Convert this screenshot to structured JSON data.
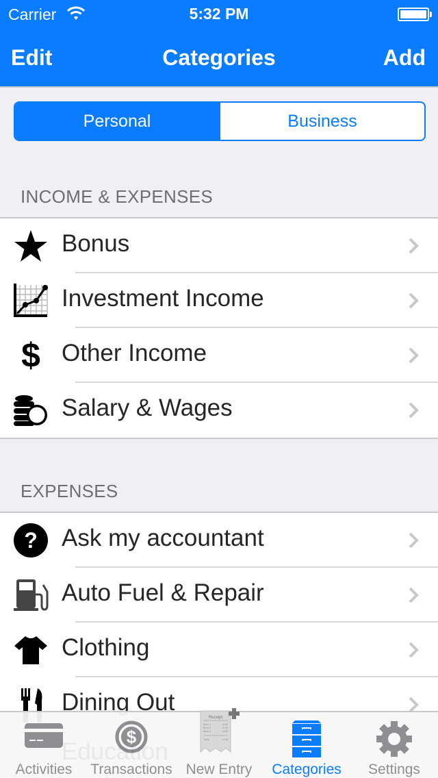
{
  "status_bar": {
    "carrier": "Carrier",
    "time": "5:32 PM",
    "battery_level": 1.0
  },
  "nav": {
    "title": "Categories",
    "left_button": "Edit",
    "right_button": "Add"
  },
  "segments": {
    "options": [
      "Personal",
      "Business"
    ],
    "selected": "Personal"
  },
  "sections": [
    {
      "header": "INCOME & EXPENSES",
      "items": [
        {
          "label": "Bonus",
          "icon": "star-icon"
        },
        {
          "label": "Investment Income",
          "icon": "chart-icon"
        },
        {
          "label": "Other Income",
          "icon": "dollar-icon"
        },
        {
          "label": "Salary & Wages",
          "icon": "coins-icon"
        }
      ]
    },
    {
      "header": "EXPENSES",
      "items": [
        {
          "label": "Ask my accountant",
          "icon": "question-icon"
        },
        {
          "label": "Auto Fuel & Repair",
          "icon": "fuel-pump-icon"
        },
        {
          "label": "Clothing",
          "icon": "tshirt-icon"
        },
        {
          "label": "Dining Out",
          "icon": "fork-knife-icon"
        },
        {
          "label": "Education",
          "icon": "graduation-cap-icon"
        }
      ]
    }
  ],
  "tabbar": {
    "items": [
      {
        "label": "Activities",
        "icon": "credit-card-icon"
      },
      {
        "label": "Transactions",
        "icon": "dollar-circle-icon"
      },
      {
        "label": "New Entry",
        "icon": "receipt-icon"
      },
      {
        "label": "Categories",
        "icon": "file-cabinet-icon"
      },
      {
        "label": "Settings",
        "icon": "gear-icon"
      }
    ],
    "selected": "Categories",
    "receipt": {
      "title": "Receipt",
      "lines": [
        [
          "Item 1",
          "1.00"
        ],
        [
          "Item 2",
          "2.00"
        ],
        [
          "Item 3",
          "3.00"
        ]
      ],
      "total_label": "Total",
      "total": "6.00"
    }
  },
  "colors": {
    "accent": "#0a7cff",
    "inactive": "#8e8e93",
    "background": "#efeff4"
  }
}
